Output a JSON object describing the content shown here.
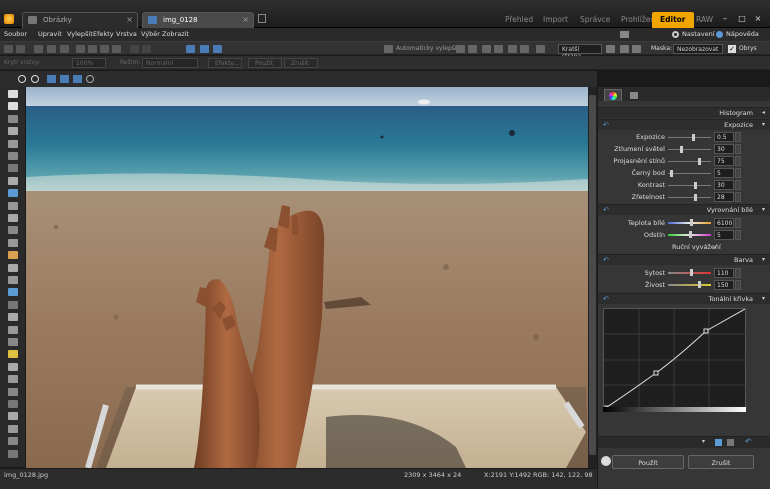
{
  "tabs": {
    "browser_tab": "Obrázky",
    "editor_tab": "img_0128"
  },
  "modes": [
    "Přehled",
    "Import",
    "Správce",
    "Prohlížeč",
    "Editor",
    "RAW"
  ],
  "active_mode": "Editor",
  "menu": [
    "Soubor",
    "Upravit",
    "Vylepšit",
    "Efekty",
    "Vrstva",
    "Výběr",
    "Zobrazit"
  ],
  "topright": {
    "settings": "Nastavení",
    "help": "Nápověda"
  },
  "toolbar1": {
    "auto_enhance": "Automaticky vylepšit",
    "short_side": "Kratší strana",
    "mask_label": "Maska:",
    "mask_value": "Nezobrazovat",
    "frame_label": "Obrys"
  },
  "toolbar2": {
    "layer_cover": "Krytí vrstvy:",
    "layer_cover_value": "100%",
    "mode_label": "Režim:",
    "mode_value": "Normální",
    "effects_btn": "Efekty...",
    "apply_btn": "Použít",
    "cancel_btn": "Zrušit"
  },
  "status": {
    "filename": "img_0128.jpg",
    "dimensions": "2309 x 3464 x 24",
    "coords": "X:2191 Y:1492",
    "rgb": "RGB: 142, 122, 98"
  },
  "panel": {
    "histogram": "Histogram",
    "exposure_section": "Expozice",
    "exposure_rows": [
      {
        "label": "Expozice",
        "value": "0.5",
        "pos": 0.6
      },
      {
        "label": "Ztlumení světel",
        "value": "30",
        "pos": 0.3
      },
      {
        "label": "Projasnění stínů",
        "value": "75",
        "pos": 0.75
      },
      {
        "label": "Černý bod",
        "value": "5",
        "pos": 0.05
      },
      {
        "label": "Kontrast",
        "value": "30",
        "pos": 0.65
      },
      {
        "label": "Zřetelnost",
        "value": "28",
        "pos": 0.64
      }
    ],
    "wb_section": "Vyrovnání bílé",
    "wb_rows": [
      {
        "label": "Teplota bílé",
        "value": "6100",
        "pos": 0.55
      },
      {
        "label": "Odstín",
        "value": "5",
        "pos": 0.52
      }
    ],
    "manual_wb": "Ruční vyvážení",
    "color_section": "Barva",
    "color_rows": [
      {
        "label": "Sytost",
        "value": "110",
        "pos": 0.55
      },
      {
        "label": "Živost",
        "value": "150",
        "pos": 0.75
      }
    ],
    "curve_section": "Tonální křivka",
    "apply": "Použít",
    "cancel": "Zrušit"
  },
  "colors": {
    "accent": "#f1a500",
    "panel_bg": "#363636",
    "link_blue": "#5b9bd5"
  }
}
